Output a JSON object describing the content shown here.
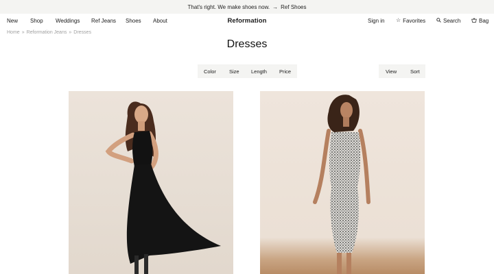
{
  "promo": {
    "text": "That's right. We make shoes now.",
    "arrow": "→",
    "link": "Ref Shoes"
  },
  "nav": {
    "left": [
      "New",
      "Shop",
      "Weddings",
      "Ref Jeans",
      "Shoes",
      "About"
    ],
    "logo": "Reformation",
    "sign_in": "Sign in",
    "favorites": "Favorites",
    "search": "Search",
    "bag": "Bag"
  },
  "breadcrumb": {
    "items": [
      "Home",
      "Reformation Jeans",
      "Dresses"
    ],
    "separator": "»"
  },
  "page_title": "Dresses",
  "filters": {
    "color": "Color",
    "size": "Size",
    "length": "Length",
    "price": "Price"
  },
  "display": {
    "view": "View",
    "sort": "Sort"
  },
  "icons": {
    "favorites": "star-icon",
    "search": "search-icon",
    "bag": "bag-icon"
  }
}
